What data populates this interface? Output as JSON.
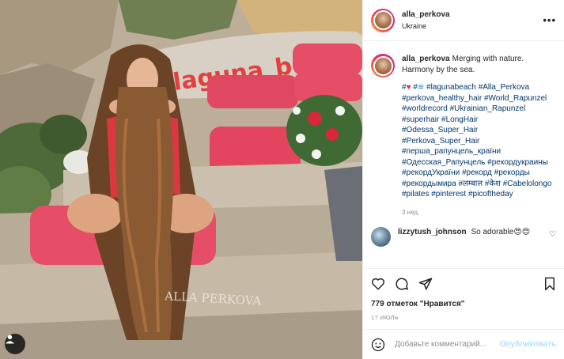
{
  "post": {
    "username": "alla_perkova",
    "location": "Ukraine",
    "more_glyph": "•••"
  },
  "photo": {
    "sign_text": "laguna_beach",
    "stone_carving": "ALLA PERKOVA",
    "user_tag_icon": "person-icon"
  },
  "caption": {
    "username": "alla_perkova",
    "text": "Merging with nature. Harmony by the sea.",
    "hashtags_line1_prefix": "#",
    "hashtags": [
      "#lagunabeach",
      "#Alla_Perkova",
      "#perkova_healthy_hair",
      "#World_Rapunzel",
      "#worldrecord",
      "#Ukrainian_Rapunzel",
      "#superhair",
      "#LongHair",
      "#Odessa_Super_Hair",
      "#Perkova_Super_Hair",
      "#перша_рапунцель_країни",
      "#Одесская_Рапунцель",
      "#рекордукраины",
      "#рекордУкраїни",
      "#рекорд",
      "#рекорды",
      "#рекордымира",
      "#लम्बाल",
      "#केश",
      "#Cabelolongo",
      "#pilates",
      "#pinterest",
      "#picoftheday"
    ],
    "time_ago": "3 нед."
  },
  "reply": {
    "username": "lizzytush_johnson",
    "text": "So adorable😍😍"
  },
  "actions": {
    "like_icon": "heart-icon",
    "comment_icon": "comment-icon",
    "share_icon": "share-icon",
    "save_icon": "bookmark-icon"
  },
  "likes_text": "779 отметок \"Нравится\"",
  "date_text": "17 ИЮЛЬ",
  "add_comment": {
    "placeholder": "Добавьте комментарий...",
    "publish_label": "Опубликовать"
  },
  "colors": {
    "link": "#00376b",
    "muted": "#8e8e8e",
    "publish_disabled": "#b2dffc",
    "cushion": "#e64d66",
    "sign_red": "#e0413f"
  }
}
